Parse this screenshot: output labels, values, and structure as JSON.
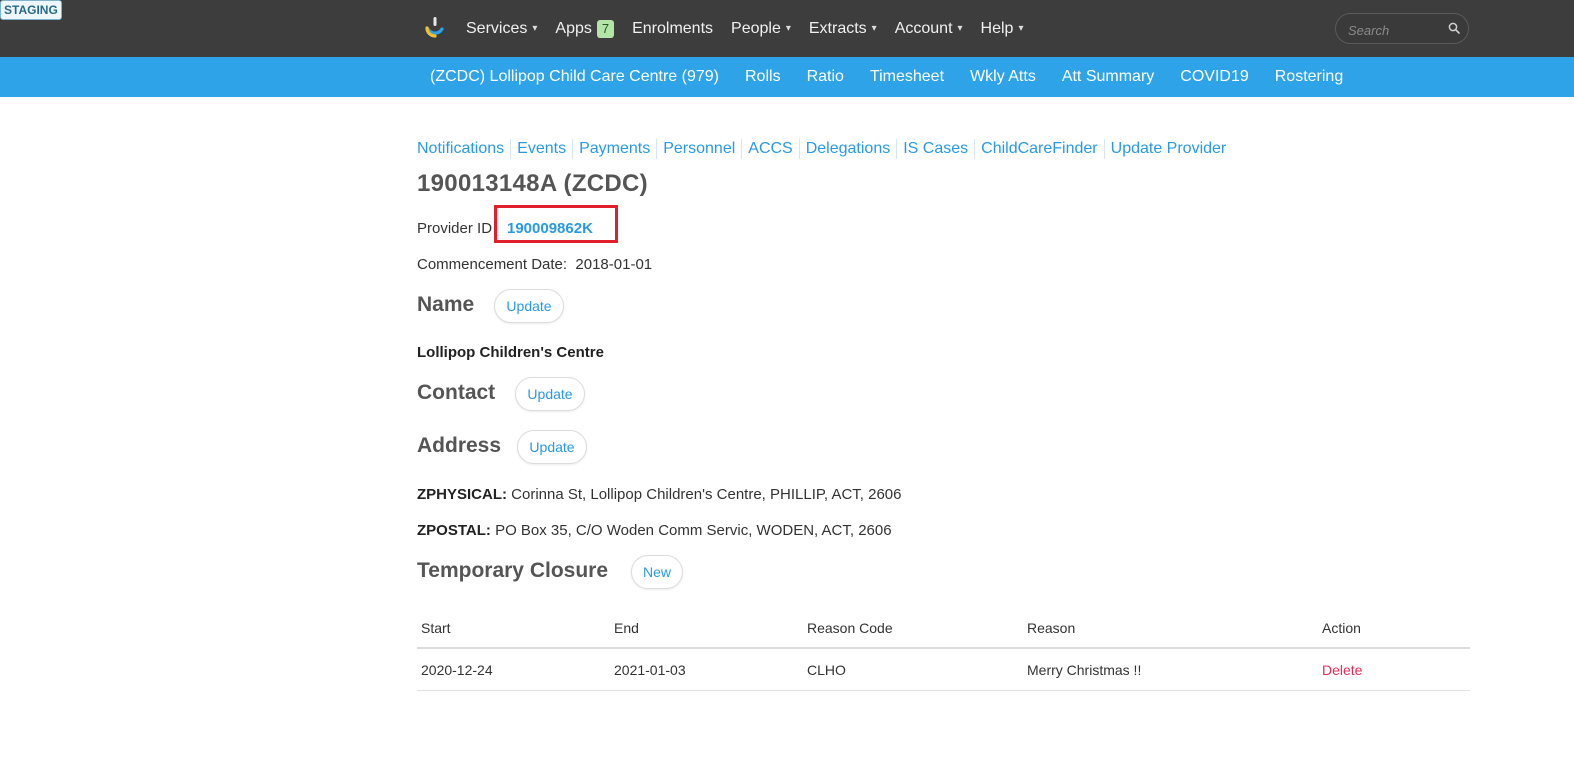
{
  "env_badge": "STAGING",
  "topnav": {
    "items": [
      {
        "label": "Services",
        "caret": "▾"
      },
      {
        "label": "Apps",
        "badge": "7"
      },
      {
        "label": "Enrolments"
      },
      {
        "label": "People",
        "caret": "▾"
      },
      {
        "label": "Extracts",
        "caret": "▾"
      },
      {
        "label": "Account",
        "caret": "▾"
      },
      {
        "label": "Help",
        "caret": "▾"
      }
    ],
    "search_placeholder": "Search"
  },
  "subnav": {
    "items": [
      "(ZCDC) Lollipop Child Care Centre (979)",
      "Rolls",
      "Ratio",
      "Timesheet",
      "Wkly Atts",
      "Att Summary",
      "COVID19",
      "Rostering"
    ]
  },
  "links": [
    "Notifications",
    "Events",
    "Payments",
    "Personnel",
    "ACCS",
    "Delegations",
    "IS Cases",
    "ChildCareFinder",
    "Update Provider"
  ],
  "service": {
    "title": "190013148A (ZCDC)",
    "provider_label": "Provider ID",
    "provider_id": "190009862K",
    "commencement_label": "Commencement Date:",
    "commencement_date": "2018-01-01"
  },
  "sections": {
    "name": {
      "heading": "Name",
      "button": "Update",
      "value": "Lollipop Children's Centre"
    },
    "contact": {
      "heading": "Contact",
      "button": "Update"
    },
    "address": {
      "heading": "Address",
      "button": "Update",
      "physical_label": "ZPHYSICAL:",
      "physical": "Corinna St, Lollipop Children's Centre, PHILLIP, ACT, 2606",
      "postal_label": "ZPOSTAL:",
      "postal": "PO Box 35, C/O Woden Comm Servic, WODEN, ACT, 2606"
    },
    "closure": {
      "heading": "Temporary Closure",
      "button": "New"
    }
  },
  "closure_table": {
    "headers": [
      "Start",
      "End",
      "Reason Code",
      "Reason",
      "Action"
    ],
    "rows": [
      {
        "start": "2020-12-24",
        "end": "2021-01-03",
        "code": "CLHO",
        "reason": "Merry Christmas !!",
        "action": "Delete"
      }
    ]
  },
  "colors": {
    "topbar": "#3d3d3d",
    "subbar": "#2ea3e8",
    "link": "#2a9ae0",
    "highlight": "#e0202a",
    "delete": "#e0305a"
  }
}
